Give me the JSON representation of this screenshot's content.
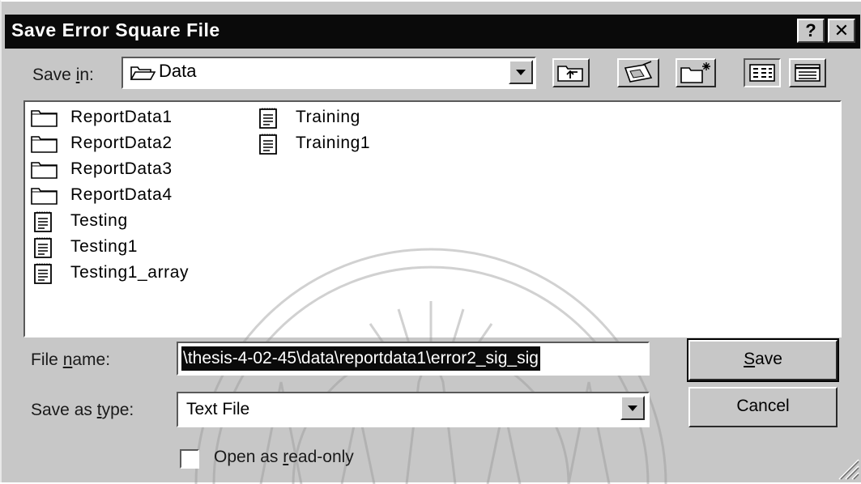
{
  "window": {
    "title": "Save Error Square File",
    "help_glyph": "?",
    "close_glyph": "✕"
  },
  "save_in": {
    "label_pre": "Save ",
    "label_mnemonic": "i",
    "label_post": "n:",
    "value": "Data",
    "icon": "folder-open-icon"
  },
  "toolbar": {
    "buttons": [
      {
        "name": "up-one-level-icon"
      },
      {
        "name": "desktop-icon"
      },
      {
        "name": "create-new-folder-icon"
      },
      {
        "name": "list-view-icon"
      },
      {
        "name": "details-view-icon"
      }
    ]
  },
  "files": {
    "column1": [
      {
        "name": "ReportData1",
        "type": "folder"
      },
      {
        "name": "ReportData2",
        "type": "folder"
      },
      {
        "name": "ReportData3",
        "type": "folder"
      },
      {
        "name": "ReportData4",
        "type": "folder"
      },
      {
        "name": "Testing",
        "type": "file"
      },
      {
        "name": "Testing1",
        "type": "file"
      },
      {
        "name": "Testing1_array",
        "type": "file"
      }
    ],
    "column2": [
      {
        "name": "Training",
        "type": "file"
      },
      {
        "name": "Training1",
        "type": "file"
      }
    ]
  },
  "file_name": {
    "label_pre": "File ",
    "label_mnemonic": "n",
    "label_post": "ame:",
    "value": "\\thesis-4-02-45\\data\\reportdata1\\error2_sig_sig"
  },
  "save_as_type": {
    "label_pre": "Save as ",
    "label_mnemonic": "t",
    "label_post": "ype:",
    "value": "Text File"
  },
  "read_only": {
    "label_pre": "Open as ",
    "label_mnemonic": "r",
    "label_post": "ead-only",
    "checked": false
  },
  "buttons": {
    "save_mnemonic": "S",
    "save_rest": "ave",
    "cancel": "Cancel"
  }
}
